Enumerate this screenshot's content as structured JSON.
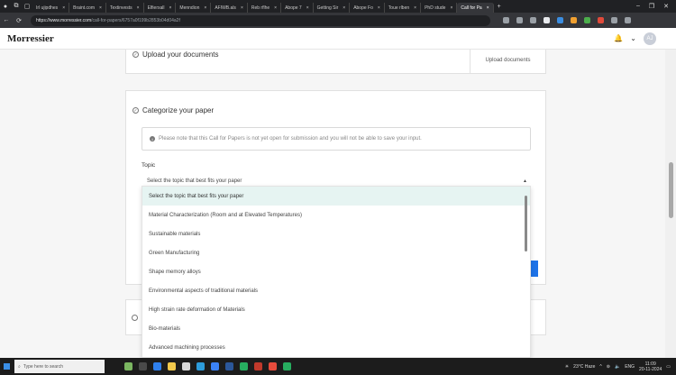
{
  "browser": {
    "tabs": [
      {
        "label": "Irl ujipdhes"
      },
      {
        "label": "Braint.com"
      },
      {
        "label": "Textinvests"
      },
      {
        "label": "Elfierxall"
      },
      {
        "label": "Menndion"
      },
      {
        "label": "AFIWB.als"
      },
      {
        "label": "Reb rflhe"
      },
      {
        "label": "Abope 7"
      },
      {
        "label": "Getting Sir"
      },
      {
        "label": "Abope Fo"
      },
      {
        "label": "Toue rlben"
      },
      {
        "label": "PhD stude"
      },
      {
        "label": "Call for Pa",
        "active": true
      }
    ],
    "url_host": "https://www.morressier.com",
    "url_path": "/call-for-papers/6757a0f199b2853b04d04a2f",
    "new_tab": "+",
    "window_controls": [
      "–",
      "❐",
      "✕"
    ]
  },
  "app": {
    "logo": "Morressier",
    "bell": "🔔",
    "chevron": "⌄",
    "avatar_initials": "AJ"
  },
  "upload_section": {
    "title": "Upload your documents",
    "button": "Upload documents"
  },
  "categorize_section": {
    "title": "Categorize your paper",
    "notice": "Please note that this Call for Papers is not yet open for submission and you will not be able to save your input.",
    "topic_label": "Topic",
    "select_value": "Select the topic that best fits your paper"
  },
  "dropdown": {
    "options": [
      {
        "label": "Select the topic that best fits your paper",
        "selected": true
      },
      {
        "label": "Material Characterization (Room and at Elevated Temperatures)"
      },
      {
        "label": "Sustainable materials"
      },
      {
        "label": "Green Manufacturing"
      },
      {
        "label": "Shape memory alloys"
      },
      {
        "label": "Environmental aspects of traditional materials"
      },
      {
        "label": "High strain rate deformation of Materials"
      },
      {
        "label": "Bio-materials"
      },
      {
        "label": "Advanced machining processes"
      }
    ]
  },
  "taskbar": {
    "search_placeholder": "Type here to search",
    "weather": "23°C Haze",
    "lang": "ENG",
    "time": "11:09",
    "date": "20-11-2024"
  },
  "colors": {
    "accent_blue": "#1e73e8",
    "selected_option": "#e6f4f2"
  }
}
